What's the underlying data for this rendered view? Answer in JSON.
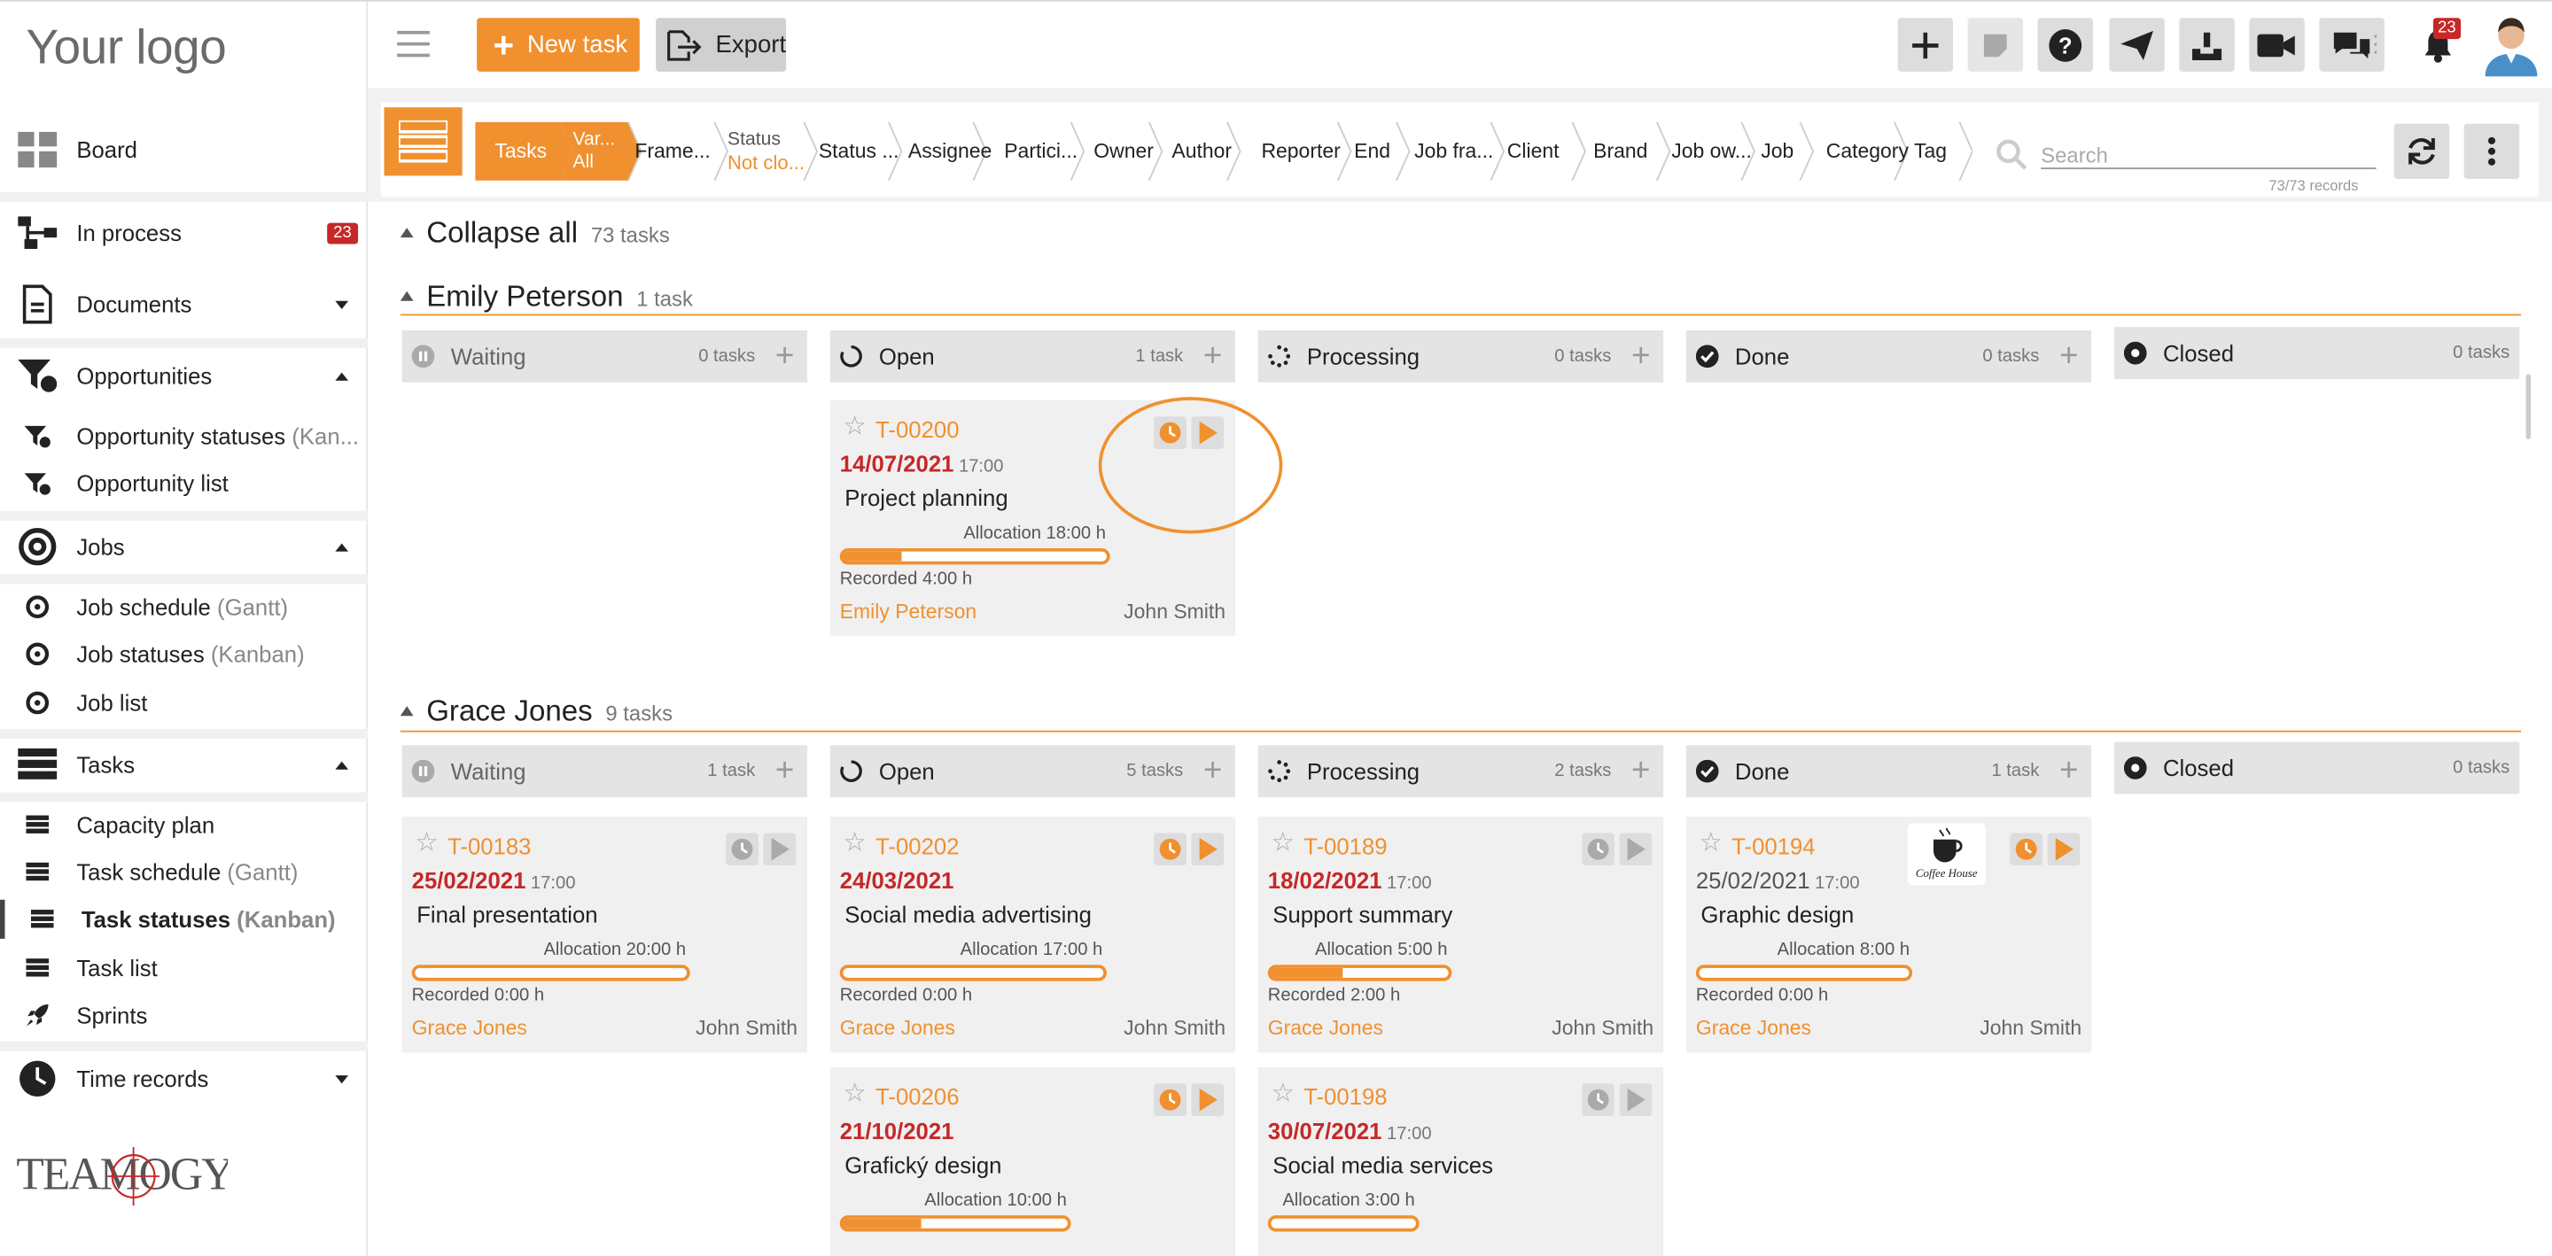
{
  "app": {
    "logo": "Your logo",
    "brand_footer": "TEAMOGY"
  },
  "sidebar": {
    "items": [
      {
        "label": "Board",
        "icon": "board-icon"
      },
      {
        "label": "In process",
        "badge": "23",
        "icon": "process-icon"
      },
      {
        "label": "Documents",
        "icon": "document-icon"
      },
      {
        "label": "Opportunities",
        "icon": "opportunities-icon"
      },
      {
        "label": "Opportunity statuses",
        "sub": "(Kan...",
        "icon": "opportunities-icon"
      },
      {
        "label": "Opportunity list",
        "icon": "opportunities-icon"
      },
      {
        "label": "Jobs",
        "icon": "target-icon"
      },
      {
        "label": "Job schedule",
        "sub": "(Gantt)",
        "icon": "target-icon"
      },
      {
        "label": "Job statuses",
        "sub": "(Kanban)",
        "icon": "target-icon"
      },
      {
        "label": "Job list",
        "icon": "target-icon"
      },
      {
        "label": "Tasks",
        "icon": "tasks-icon"
      },
      {
        "label": "Capacity plan",
        "icon": "tasks-icon"
      },
      {
        "label": "Task schedule",
        "sub": "(Gantt)",
        "icon": "tasks-icon"
      },
      {
        "label": "Task statuses",
        "sub": "(Kanban)",
        "icon": "tasks-icon",
        "active": true
      },
      {
        "label": "Task list",
        "icon": "tasks-icon"
      },
      {
        "label": "Sprints",
        "icon": "rocket-icon"
      },
      {
        "label": "Time records",
        "icon": "clock-icon"
      }
    ]
  },
  "topbar": {
    "new_task": "New task",
    "export": "Export",
    "notification_count": "23"
  },
  "filters": {
    "tasks": "Tasks",
    "var_top": "Var...",
    "var_bottom": "All",
    "items": [
      "Frame...",
      "Status ...",
      "Assignee",
      "Partici...",
      "Owner",
      "Author",
      "Reporter",
      "End",
      "Job fra...",
      "Client",
      "Brand",
      "Job ow...",
      "Job",
      "Category",
      "Tag"
    ],
    "status_top": "Status",
    "status_bottom": "Not clo..."
  },
  "search": {
    "placeholder": "Search",
    "records": "73/73 records"
  },
  "board": {
    "collapse_all": "Collapse all",
    "total": "73 tasks",
    "columns": [
      "Waiting",
      "Open",
      "Processing",
      "Done",
      "Closed"
    ],
    "groups": [
      {
        "name": "Emily Peterson",
        "count": "1 task",
        "col_counts": [
          "0 tasks",
          "1 task",
          "0 tasks",
          "0 tasks",
          "0 tasks"
        ]
      },
      {
        "name": "Grace Jones",
        "count": "9 tasks",
        "col_counts": [
          "1 task",
          "5 tasks",
          "2 tasks",
          "1 task",
          "0 tasks"
        ]
      }
    ],
    "cards": [
      {
        "id": "T-00200",
        "date": "14/07/2021",
        "time": "17:00",
        "title": "Project planning",
        "allocation": "Allocation 18:00 h",
        "progress": 0.22,
        "recorded": "Recorded 4:00 h",
        "owner": "Emily Peterson",
        "author": "John Smith"
      },
      {
        "id": "T-00183",
        "date": "25/02/2021",
        "time": "17:00",
        "title": "Final presentation",
        "allocation": "Allocation 20:00 h",
        "progress": 0,
        "recorded": "Recorded 0:00 h",
        "owner": "Grace Jones",
        "author": "John Smith"
      },
      {
        "id": "T-00202",
        "date": "24/03/2021",
        "time": "",
        "title": "Social media advertising",
        "allocation": "Allocation 17:00 h",
        "progress": 0,
        "recorded": "Recorded 0:00 h",
        "owner": "Grace Jones",
        "author": "John Smith"
      },
      {
        "id": "T-00189",
        "date": "18/02/2021",
        "time": "17:00",
        "title": "Support summary",
        "allocation": "Allocation 5:00 h",
        "progress": 0.4,
        "recorded": "Recorded 2:00 h",
        "owner": "Grace Jones",
        "author": "John Smith"
      },
      {
        "id": "T-00194",
        "date": "25/02/2021",
        "time": "17:00",
        "title": "Graphic design",
        "allocation": "Allocation 8:00 h",
        "progress": 0,
        "recorded": "Recorded 0:00 h",
        "owner": "Grace Jones",
        "author": "John Smith",
        "image_text": "Coffee House"
      },
      {
        "id": "T-00206",
        "date": "21/10/2021",
        "time": "",
        "title": "Grafický design",
        "allocation": "Allocation 10:00 h",
        "progress": 0.35
      },
      {
        "id": "T-00198",
        "date": "30/07/2021",
        "time": "17:00",
        "title": "Social media services",
        "allocation": "Allocation 3:00 h",
        "progress": 0
      }
    ]
  },
  "colors": {
    "accent": "#f0902f",
    "danger": "#c62828"
  }
}
